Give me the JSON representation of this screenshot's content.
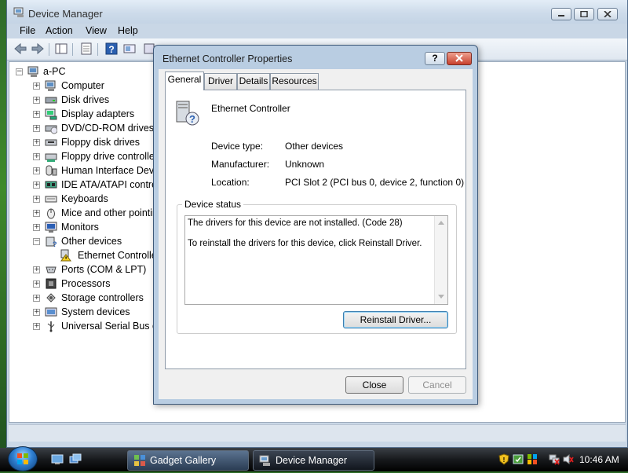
{
  "main_window": {
    "title": "Device Manager",
    "menu": [
      "File",
      "Action",
      "View",
      "Help"
    ],
    "tree": {
      "root": "a-PC",
      "items": [
        {
          "label": "Computer",
          "icon": "computer-icon",
          "expanded": false
        },
        {
          "label": "Disk drives",
          "icon": "disk-drive-icon",
          "expanded": false
        },
        {
          "label": "Display adapters",
          "icon": "display-adapter-icon",
          "expanded": false
        },
        {
          "label": "DVD/CD-ROM drives",
          "icon": "dvd-drive-icon",
          "expanded": false
        },
        {
          "label": "Floppy disk drives",
          "icon": "floppy-disk-icon",
          "expanded": false
        },
        {
          "label": "Floppy drive controllers",
          "icon": "floppy-controller-icon",
          "expanded": false
        },
        {
          "label": "Human Interface Devices",
          "icon": "hid-icon",
          "expanded": false
        },
        {
          "label": "IDE ATA/ATAPI controllers",
          "icon": "ide-controller-icon",
          "expanded": false
        },
        {
          "label": "Keyboards",
          "icon": "keyboard-icon",
          "expanded": false
        },
        {
          "label": "Mice and other pointing devices",
          "icon": "mouse-icon",
          "expanded": false
        },
        {
          "label": "Monitors",
          "icon": "monitor-icon",
          "expanded": false
        },
        {
          "label": "Other devices",
          "icon": "unknown-device-icon",
          "expanded": true,
          "children": [
            {
              "label": "Ethernet Controller",
              "icon": "warning-device-icon"
            }
          ]
        },
        {
          "label": "Ports (COM & LPT)",
          "icon": "port-icon",
          "expanded": false
        },
        {
          "label": "Processors",
          "icon": "processor-icon",
          "expanded": false
        },
        {
          "label": "Storage controllers",
          "icon": "storage-controller-icon",
          "expanded": false
        },
        {
          "label": "System devices",
          "icon": "system-device-icon",
          "expanded": false
        },
        {
          "label": "Universal Serial Bus controllers",
          "icon": "usb-icon",
          "expanded": false
        }
      ]
    }
  },
  "dialog": {
    "title": "Ethernet Controller Properties",
    "help_label": "?",
    "tabs": [
      "General",
      "Driver",
      "Details",
      "Resources"
    ],
    "active_tab": "General",
    "device_name": "Ethernet Controller",
    "properties": [
      {
        "label": "Device type:",
        "value": "Other devices"
      },
      {
        "label": "Manufacturer:",
        "value": "Unknown"
      },
      {
        "label": "Location:",
        "value": "PCI Slot 2 (PCI bus 0, device 2, function 0)"
      }
    ],
    "status_group_label": "Device status",
    "status_lines": [
      "The drivers for this device are not installed. (Code 28)",
      "To reinstall the drivers for this device, click Reinstall Driver."
    ],
    "reinstall_label": "Reinstall Driver...",
    "close_label": "Close",
    "cancel_label": "Cancel"
  },
  "taskbar": {
    "tasks": [
      {
        "label": "Gadget Gallery",
        "icon": "gadget-icon"
      },
      {
        "label": "Device Manager",
        "icon": "device-manager-icon"
      }
    ],
    "clock": "10:46 AM"
  }
}
